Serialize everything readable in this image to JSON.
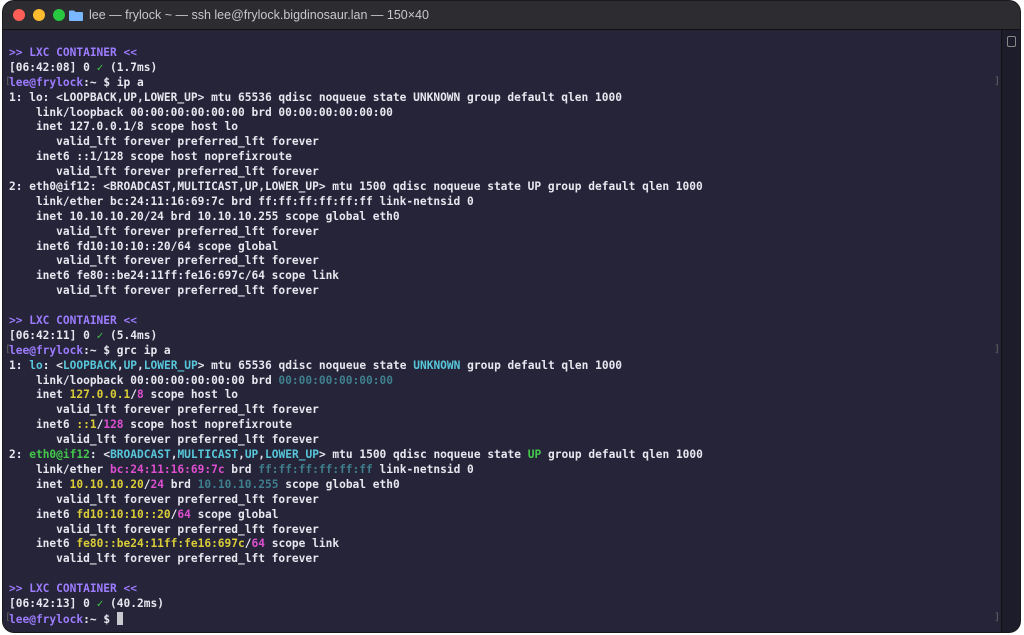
{
  "window": {
    "title": "lee — frylock ~ — ssh lee@frylock.bigdinosaur.lan — 150×40"
  },
  "colors": {
    "fg": "#e7e7ef",
    "purple": "#9d7cff",
    "green": "#43c84a",
    "cyan": "#57c7d9",
    "magenta": "#dd4fcf",
    "yellow": "#d9cc37",
    "dim": "#3f7e8c",
    "bg": "#252439"
  },
  "lines": [
    [
      {
        "t": ">> LXC CONTAINER <<",
        "c": "purple"
      }
    ],
    [
      {
        "t": "[06:42:08] 0 "
      },
      {
        "t": "✓",
        "c": "green"
      },
      {
        "t": " (1.7ms)"
      }
    ],
    [
      {
        "t": "lee@frylock",
        "c": "purple"
      },
      {
        "t": ":~ "
      },
      {
        "t": "$ ip a"
      }
    ],
    [
      {
        "t": "1: lo: <LOOPBACK,UP,LOWER_UP> mtu 65536 qdisc noqueue state UNKNOWN group default qlen 1000"
      }
    ],
    [
      {
        "t": "    link/loopback 00:00:00:00:00:00 brd 00:00:00:00:00:00"
      }
    ],
    [
      {
        "t": "    inet 127.0.0.1/8 scope host lo"
      }
    ],
    [
      {
        "t": "       valid_lft forever preferred_lft forever"
      }
    ],
    [
      {
        "t": "    inet6 ::1/128 scope host noprefixroute"
      }
    ],
    [
      {
        "t": "       valid_lft forever preferred_lft forever"
      }
    ],
    [
      {
        "t": "2: eth0@if12: <BROADCAST,MULTICAST,UP,LOWER_UP> mtu 1500 qdisc noqueue state UP group default qlen 1000"
      }
    ],
    [
      {
        "t": "    link/ether bc:24:11:16:69:7c brd ff:ff:ff:ff:ff:ff link-netnsid 0"
      }
    ],
    [
      {
        "t": "    inet 10.10.10.20/24 brd 10.10.10.255 scope global eth0"
      }
    ],
    [
      {
        "t": "       valid_lft forever preferred_lft forever"
      }
    ],
    [
      {
        "t": "    inet6 fd10:10:10::20/64 scope global"
      }
    ],
    [
      {
        "t": "       valid_lft forever preferred_lft forever"
      }
    ],
    [
      {
        "t": "    inet6 fe80::be24:11ff:fe16:697c/64 scope link"
      }
    ],
    [
      {
        "t": "       valid_lft forever preferred_lft forever"
      }
    ],
    [
      {
        "t": ""
      }
    ],
    [
      {
        "t": ">> LXC CONTAINER <<",
        "c": "purple"
      }
    ],
    [
      {
        "t": "[06:42:11] 0 "
      },
      {
        "t": "✓",
        "c": "green"
      },
      {
        "t": " (5.4ms)"
      }
    ],
    [
      {
        "t": "lee@frylock",
        "c": "purple"
      },
      {
        "t": ":~ "
      },
      {
        "t": "$ grc ip a"
      }
    ],
    [
      {
        "t": "1: "
      },
      {
        "t": "lo",
        "c": "cyan"
      },
      {
        "t": ": <"
      },
      {
        "t": "LOOPBACK",
        "c": "cyan"
      },
      {
        "t": ","
      },
      {
        "t": "UP",
        "c": "cyan"
      },
      {
        "t": ","
      },
      {
        "t": "LOWER_UP",
        "c": "cyan"
      },
      {
        "t": "> mtu 65536 qdisc noqueue state "
      },
      {
        "t": "UNKNOWN",
        "c": "cyan"
      },
      {
        "t": " group default qlen 1000"
      }
    ],
    [
      {
        "t": "    link/loopback 00:00:00:00:00:00 brd "
      },
      {
        "t": "00:00:00:00:00:00",
        "c": "dim"
      }
    ],
    [
      {
        "t": "    inet "
      },
      {
        "t": "127.0.0.1",
        "c": "yellow"
      },
      {
        "t": "/"
      },
      {
        "t": "8",
        "c": "magenta"
      },
      {
        "t": " scope host lo"
      }
    ],
    [
      {
        "t": "       valid_lft forever preferred_lft forever"
      }
    ],
    [
      {
        "t": "    inet6 "
      },
      {
        "t": "::1",
        "c": "yellow"
      },
      {
        "t": "/"
      },
      {
        "t": "128",
        "c": "magenta"
      },
      {
        "t": " scope host noprefixroute"
      }
    ],
    [
      {
        "t": "       valid_lft forever preferred_lft forever"
      }
    ],
    [
      {
        "t": "2: "
      },
      {
        "t": "eth0@if12",
        "c": "green"
      },
      {
        "t": ": <"
      },
      {
        "t": "BROADCAST",
        "c": "cyan"
      },
      {
        "t": ","
      },
      {
        "t": "MULTICAST",
        "c": "cyan"
      },
      {
        "t": ","
      },
      {
        "t": "UP",
        "c": "cyan"
      },
      {
        "t": ","
      },
      {
        "t": "LOWER_UP",
        "c": "cyan"
      },
      {
        "t": "> mtu 1500 qdisc noqueue state "
      },
      {
        "t": "UP",
        "c": "green"
      },
      {
        "t": " group default qlen 1000"
      }
    ],
    [
      {
        "t": "    link/ether "
      },
      {
        "t": "bc:24:11:16:69:7c",
        "c": "magenta"
      },
      {
        "t": " brd "
      },
      {
        "t": "ff:ff:ff:ff:ff:ff",
        "c": "dim"
      },
      {
        "t": " link-netnsid 0"
      }
    ],
    [
      {
        "t": "    inet "
      },
      {
        "t": "10.10.10.20",
        "c": "yellow"
      },
      {
        "t": "/"
      },
      {
        "t": "24",
        "c": "magenta"
      },
      {
        "t": " brd "
      },
      {
        "t": "10.10.10.255",
        "c": "dim"
      },
      {
        "t": " scope global eth0"
      }
    ],
    [
      {
        "t": "       valid_lft forever preferred_lft forever"
      }
    ],
    [
      {
        "t": "    inet6 "
      },
      {
        "t": "fd10:10:10::20",
        "c": "yellow"
      },
      {
        "t": "/"
      },
      {
        "t": "64",
        "c": "magenta"
      },
      {
        "t": " scope global"
      }
    ],
    [
      {
        "t": "       valid_lft forever preferred_lft forever"
      }
    ],
    [
      {
        "t": "    inet6 "
      },
      {
        "t": "fe80::be24:11ff:fe16:697c",
        "c": "yellow"
      },
      {
        "t": "/"
      },
      {
        "t": "64",
        "c": "magenta"
      },
      {
        "t": " scope link"
      }
    ],
    [
      {
        "t": "       valid_lft forever preferred_lft forever"
      }
    ],
    [
      {
        "t": ""
      }
    ],
    [
      {
        "t": ">> LXC CONTAINER <<",
        "c": "purple"
      }
    ],
    [
      {
        "t": "[06:42:13] 0 "
      },
      {
        "t": "✓",
        "c": "green"
      },
      {
        "t": " (40.2ms)"
      }
    ],
    [
      {
        "t": "lee@frylock",
        "c": "purple"
      },
      {
        "t": ":~ "
      },
      {
        "t": "$ "
      }
    ]
  ],
  "prompt_line_indexes": [
    2,
    20,
    38
  ]
}
